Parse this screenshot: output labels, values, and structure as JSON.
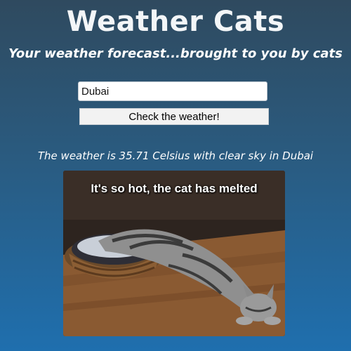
{
  "header": {
    "title": "Weather Cats",
    "subtitle": "Your weather forecast...brought to you by cats"
  },
  "form": {
    "city_value": "Dubai",
    "button_label": "Check the weather!"
  },
  "result": {
    "weather_text": "The weather is 35.71 Celsius with clear sky in Dubai"
  },
  "image": {
    "caption": "It's so hot, the cat has melted"
  },
  "colors": {
    "background_top": "#2f4a5f",
    "background_bottom": "#1f6fae",
    "text": "#ffffff"
  }
}
